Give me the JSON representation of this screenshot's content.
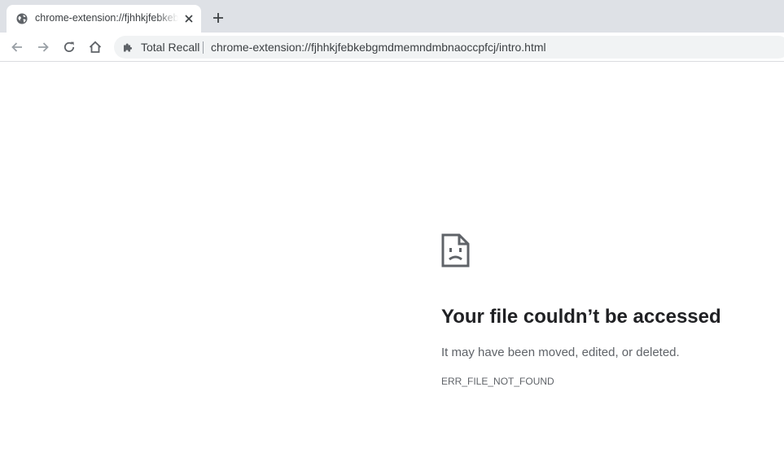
{
  "tab": {
    "title": "chrome-extension://fjhhkjfebkebgmdmemndmbnaoccpfcj/intro.html",
    "favicon": "globe-icon"
  },
  "toolbar": {
    "back_icon": "arrow-left-icon",
    "forward_icon": "arrow-right-icon",
    "reload_icon": "reload-icon",
    "home_icon": "home-icon"
  },
  "omnibox": {
    "extension_icon": "puzzle-icon",
    "extension_name": "Total Recall",
    "url": "chrome-extension://fjhhkjfebkebgmdmemndmbnaoccpfcj/intro.html"
  },
  "error": {
    "icon": "sad-file-icon",
    "title": "Your file couldn’t be accessed",
    "description": "It may have been moved, edited, or deleted.",
    "code": "ERR_FILE_NOT_FOUND"
  },
  "colors": {
    "tabstrip": "#dee1e6",
    "omnibox": "#f1f3f4",
    "text_primary": "#202124",
    "text_secondary": "#5f6368"
  }
}
